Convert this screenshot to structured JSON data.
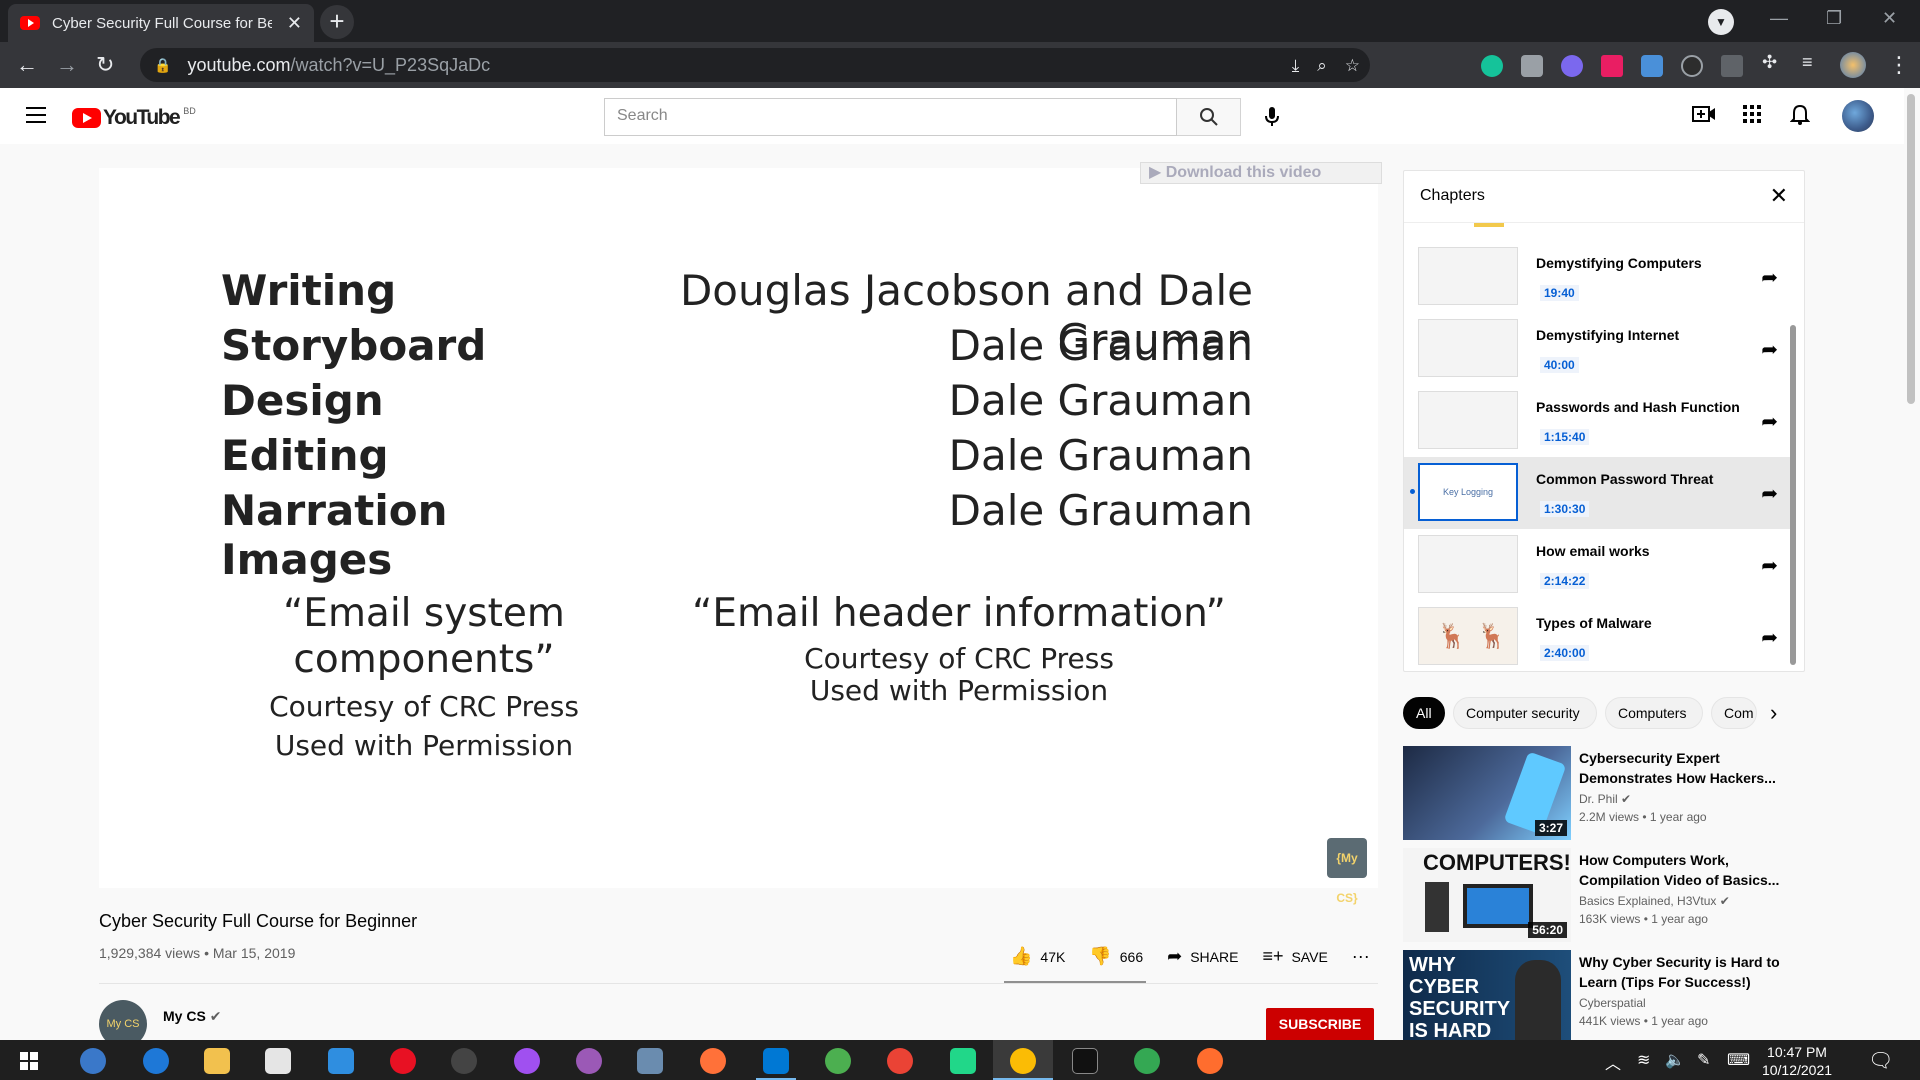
{
  "browser": {
    "tab_title": "Cyber Security Full Course for Be",
    "tab_close": "✕",
    "new_tab": "+",
    "url_host": "youtube.com",
    "url_path": "/watch?v=U_P23SqJaDc"
  },
  "header": {
    "logo_text": "YouTube",
    "logo_region": "BD",
    "search_placeholder": "Search"
  },
  "player": {
    "download_bar": "▶ Download this video",
    "credits": [
      {
        "role": "Writing",
        "name": "Douglas Jacobson and Dale Grauman"
      },
      {
        "role": "Storyboard",
        "name": "Dale Grauman"
      },
      {
        "role": "Design",
        "name": "Dale Grauman"
      },
      {
        "role": "Editing",
        "name": "Dale Grauman"
      },
      {
        "role": "Narration",
        "name": "Dale Grauman"
      },
      {
        "role": "Images",
        "name": ""
      }
    ],
    "image_credit_left": {
      "title_line1": "“Email system",
      "title_line2": "components”",
      "line1": "Courtesy of CRC Press",
      "line2": "Used with Permission"
    },
    "image_credit_right": {
      "title": "“Email header information”",
      "line1": "Courtesy of CRC Press",
      "line2": "Used with Permission"
    },
    "corner_logo": "{My CS}"
  },
  "video": {
    "title": "Cyber Security Full Course for Beginner",
    "meta": "1,929,384 views • Mar 15, 2019",
    "likes": "47K",
    "dislikes": "666",
    "share_label": "SHARE",
    "save_label": "SAVE",
    "more": "···",
    "channel_name": "My CS",
    "channel_avatar_text": "My CS",
    "subscribe_label": "SUBSCRIBE"
  },
  "chapters": {
    "title": "Chapters",
    "items": [
      {
        "name": "Demystifying Computers",
        "time": "19:40"
      },
      {
        "name": "Demystifying Internet",
        "time": "40:00"
      },
      {
        "name": "Passwords and Hash Function",
        "time": "1:15:40"
      },
      {
        "name": "Common Password Threat",
        "time": "1:30:30",
        "active": true,
        "thumb_text": "Key Logging"
      },
      {
        "name": "How email works",
        "time": "2:14:22"
      },
      {
        "name": "Types of Malware",
        "time": "2:40:00"
      }
    ]
  },
  "chips": [
    "All",
    "Computer security",
    "Computers",
    "Com"
  ],
  "recommendations": [
    {
      "title": "Cybersecurity Expert Demonstrates How Hackers...",
      "channel": "Dr. Phil",
      "meta": "2.2M views • 1 year ago",
      "duration": "3:27",
      "thumb_text": ""
    },
    {
      "title": "How Computers Work, Compilation Video of Basics...",
      "channel": "Basics Explained, H3Vtux",
      "meta": "163K views • 1 year ago",
      "duration": "56:20",
      "thumb_text": "COMPUTERS!"
    },
    {
      "title": "Why Cyber Security is Hard to Learn (Tips For Success!)",
      "channel": "Cyberspatial",
      "meta": "441K views • 1 year ago",
      "duration": "",
      "thumb_text": "WHY CYBER SECURITY IS HARD"
    }
  ],
  "taskbar": {
    "time": "10:47 PM",
    "date": "10/12/2021"
  },
  "colors": {
    "brand_red": "#ff0000",
    "link_blue": "#065fd4",
    "subscribe_red": "#cc0000"
  }
}
